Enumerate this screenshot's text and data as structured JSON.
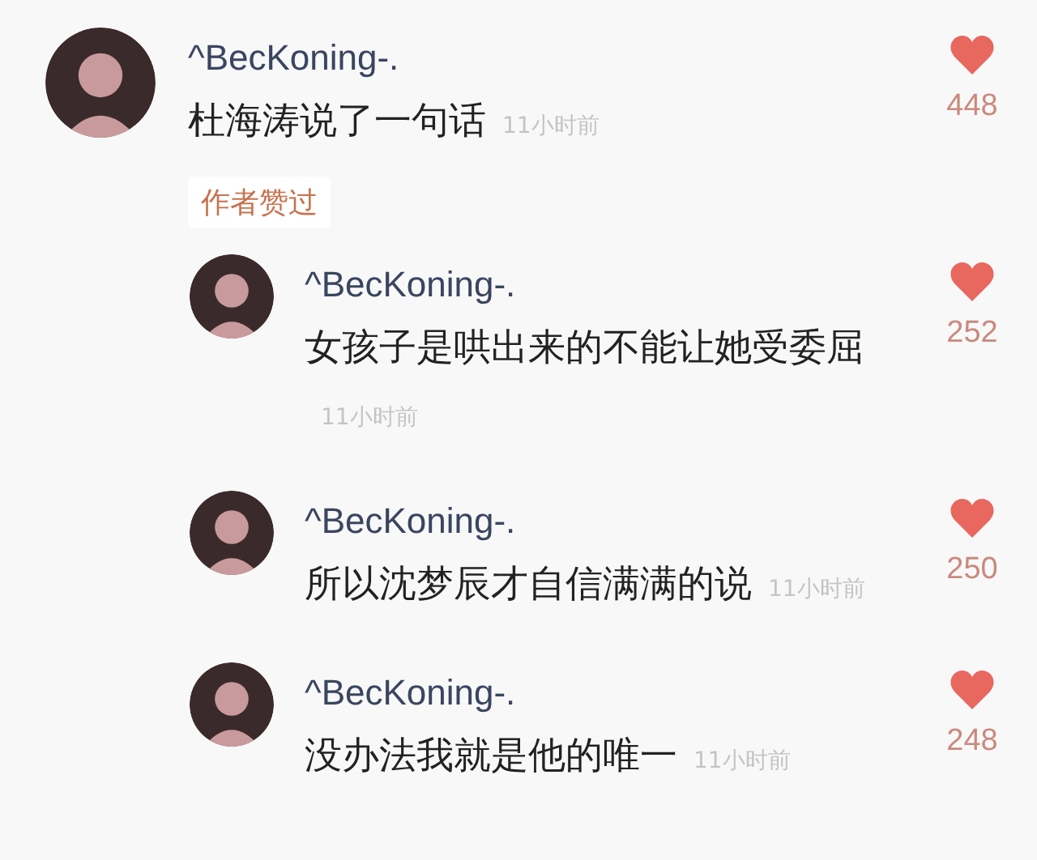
{
  "comment": {
    "author": "^BecKoning-.",
    "text": "杜海涛说了一句话",
    "time": "11小时前",
    "likes": "448",
    "liked": true,
    "badge": "作者赞过"
  },
  "replies": [
    {
      "author": "^BecKoning-.",
      "text": "女孩子是哄出来的不能让她受委屈",
      "time": "11小时前",
      "likes": "252",
      "liked": true
    },
    {
      "author": "^BecKoning-.",
      "text": "所以沈梦辰才自信满满的说",
      "time": "11小时前",
      "likes": "250",
      "liked": true
    },
    {
      "author": "^BecKoning-.",
      "text": "没办法我就是他的唯一",
      "time": "11小时前",
      "likes": "248",
      "liked": true
    }
  ]
}
